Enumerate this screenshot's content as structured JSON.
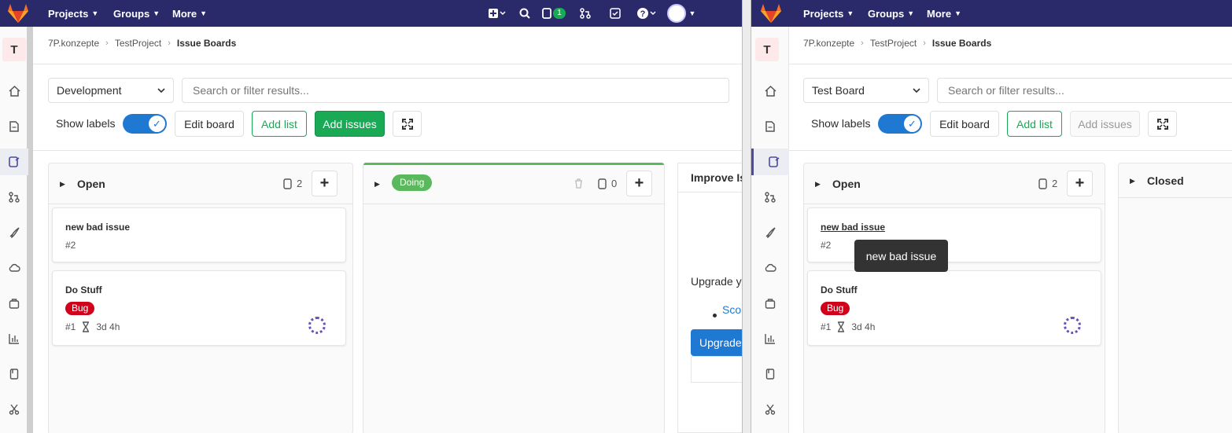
{
  "nav": {
    "projects": "Projects",
    "groups": "Groups",
    "more": "More",
    "todo_count": "1"
  },
  "project_avatar_letter": "T",
  "breadcrumb": {
    "group": "7P.konzepte",
    "project": "TestProject",
    "current": "Issue Boards"
  },
  "left": {
    "board_name": "Development",
    "search_placeholder": "Search or filter results...",
    "show_labels": "Show labels",
    "edit_board": "Edit board",
    "add_list": "Add list",
    "add_issues": "Add issues",
    "lists": [
      {
        "title": "Open",
        "count": "2"
      },
      {
        "label": "Doing",
        "count": "0"
      }
    ],
    "cards": [
      {
        "title": "new bad issue",
        "ref": "#2"
      },
      {
        "title": "Do Stuff",
        "label": "Bug",
        "ref": "#1",
        "time": "3d 4h"
      }
    ],
    "promo": {
      "title": "Improve Is",
      "text": "Upgrade y",
      "link": "Scop",
      "button": "Upgrade"
    }
  },
  "right": {
    "board_name": "Test Board",
    "search_placeholder": "Search or filter results...",
    "show_labels": "Show labels",
    "edit_board": "Edit board",
    "add_list": "Add list",
    "add_issues": "Add issues",
    "lists": [
      {
        "title": "Open",
        "count": "2"
      },
      {
        "title": "Closed"
      }
    ],
    "cards": [
      {
        "title": "new bad issue",
        "ref": "#2"
      },
      {
        "title": "Do Stuff",
        "label": "Bug",
        "ref": "#1",
        "time": "3d 4h"
      }
    ],
    "tooltip": "new bad issue"
  },
  "colors": {
    "navbar": "#2a2a6b",
    "green": "#1aaa55",
    "blue": "#1f78d1",
    "bug": "#d0021b",
    "doing": "#5cb85c"
  }
}
